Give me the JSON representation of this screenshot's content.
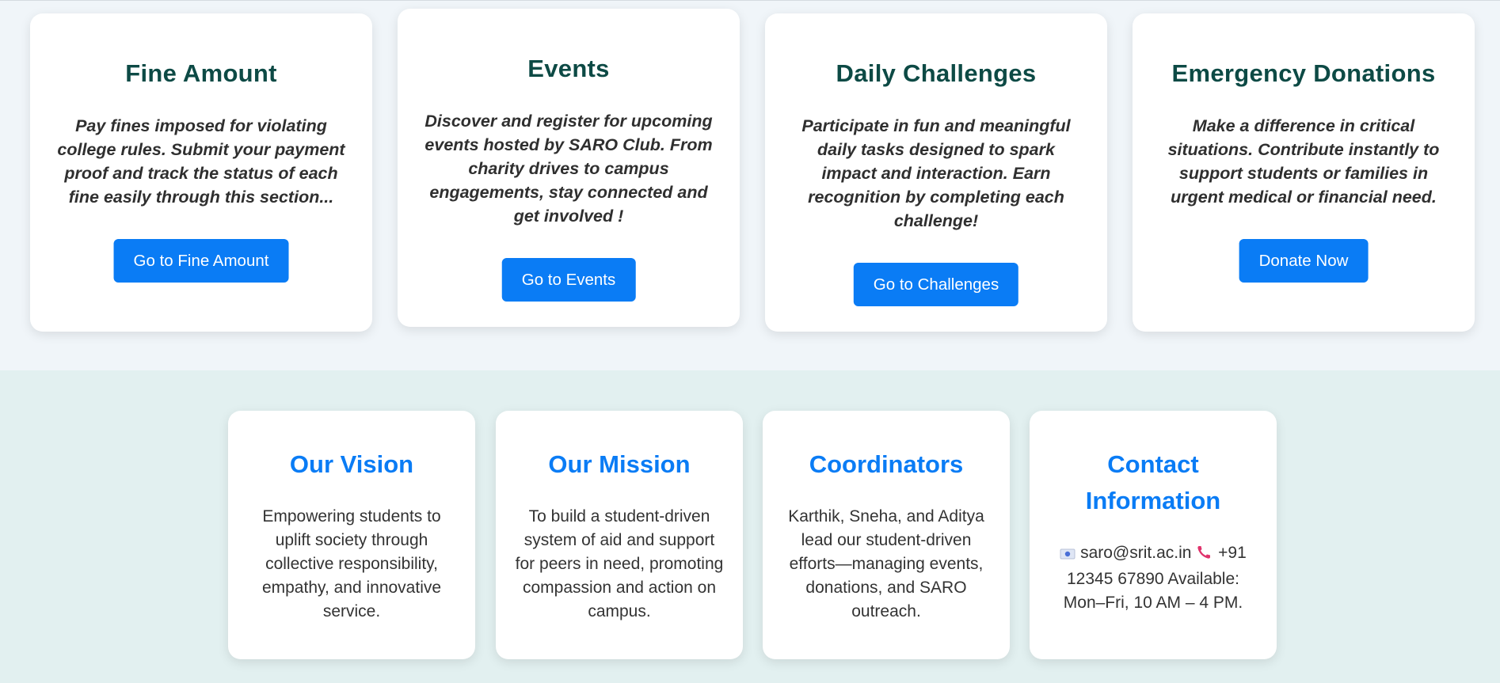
{
  "services": [
    {
      "title": "Fine Amount",
      "desc": "Pay fines imposed for violating college rules. Submit your payment proof and track the status of each fine easily through this section...",
      "button": "Go to Fine Amount"
    },
    {
      "title": "Events",
      "desc": "Discover and register for upcoming events hosted by SARO Club. From charity drives to campus engagements, stay connected and get involved !",
      "button": "Go to Events"
    },
    {
      "title": "Daily Challenges",
      "desc": "Participate in fun and meaningful daily tasks designed to spark impact and interaction. Earn recognition by completing each challenge!",
      "button": "Go to Challenges"
    },
    {
      "title": "Emergency Donations",
      "desc": "Make a difference in critical situations. Contribute instantly to support students or families in urgent medical or financial need.",
      "button": "Donate Now"
    }
  ],
  "info": [
    {
      "title": "Our Vision",
      "body": "Empowering students to uplift society through collective responsibility, empathy, and innovative service."
    },
    {
      "title": "Our Mission",
      "body": "To build a student-driven system of aid and support for peers in need, promoting compassion and action on campus."
    },
    {
      "title": "Coordinators",
      "body": "Karthik, Sneha, and Aditya lead our student-driven efforts—managing events, donations, and SARO outreach."
    },
    {
      "title": "Contact Information",
      "email": "saro@srit.ac.in",
      "phone": "+91 12345 67890",
      "availability": "Available: Mon–Fri, 10 AM – 4 PM."
    }
  ],
  "colors": {
    "accent": "#0a7cf5",
    "service_title": "#0d4a45"
  }
}
